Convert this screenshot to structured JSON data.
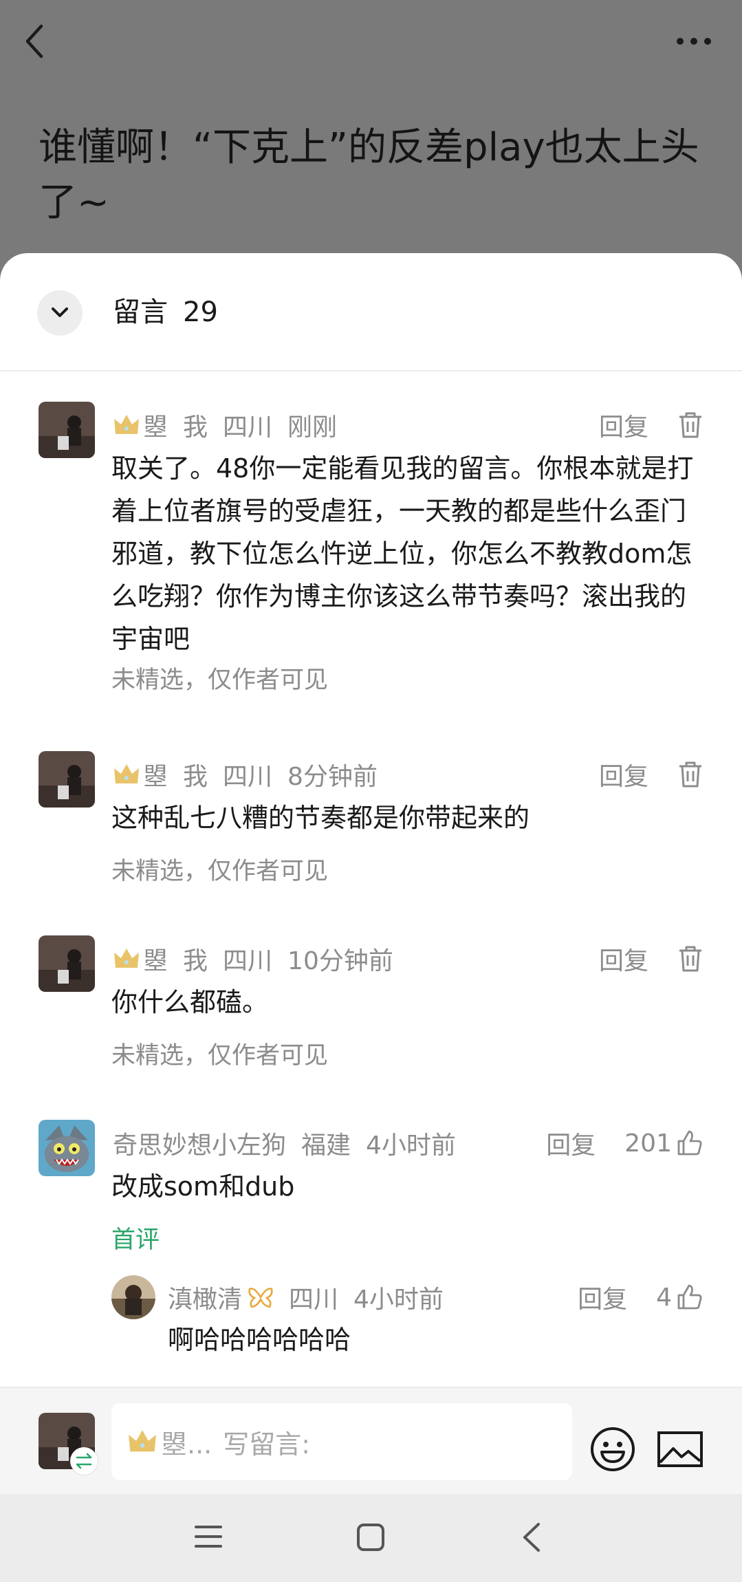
{
  "article": {
    "title": "谁懂啊！“下克上”的反差play也太上头了~"
  },
  "comments_sheet": {
    "title": "留言",
    "count": "29"
  },
  "comments": [
    {
      "user": "曌",
      "me_tag": "我",
      "location": "四川",
      "time": "刚刚",
      "reply_label": "回复",
      "text": "取关了。48你一定能看见我的留言。你根本就是打着上位者旗号的受虐狂，一天教的都是些什么歪门邪道，教下位怎么忤逆上位，你怎么不教教dom怎么吃翔？你作为博主你该这么带节奏吗？滚出我的宇宙吧",
      "note": "未精选，仅作者可见"
    },
    {
      "user": "曌",
      "me_tag": "我",
      "location": "四川",
      "time": "8分钟前",
      "reply_label": "回复",
      "text": "这种乱七八糟的节奏都是你带起来的",
      "note": "未精选，仅作者可见"
    },
    {
      "user": "曌",
      "me_tag": "我",
      "location": "四川",
      "time": "10分钟前",
      "reply_label": "回复",
      "text": "你什么都磕。",
      "note": "未精选，仅作者可见"
    },
    {
      "user": "奇思妙想小左狗",
      "location": "福建",
      "time": "4小时前",
      "reply_label": "回复",
      "likes": "201",
      "text": "改成som和dub",
      "badge": "首评"
    }
  ],
  "reply": {
    "user": "滇橄清",
    "location": "四川",
    "time": "4小时前",
    "reply_label": "回复",
    "likes": "4",
    "text": "啊哈哈哈哈哈哈"
  },
  "input_bar": {
    "placeholder_name": "曌...",
    "placeholder_text": "写留言:"
  },
  "icons": {
    "back": "chevron-left-icon",
    "more": "more-dots-icon",
    "collapse": "chevron-down-icon",
    "delete": "trash-icon",
    "like": "thumbs-up-icon",
    "crown": "crown-icon",
    "emoji": "emoji-icon",
    "image": "image-icon"
  },
  "colors": {
    "accent_green": "#2ba56a",
    "crown_gold": "#e8c36a",
    "meta_gray": "#8c8c8c"
  }
}
